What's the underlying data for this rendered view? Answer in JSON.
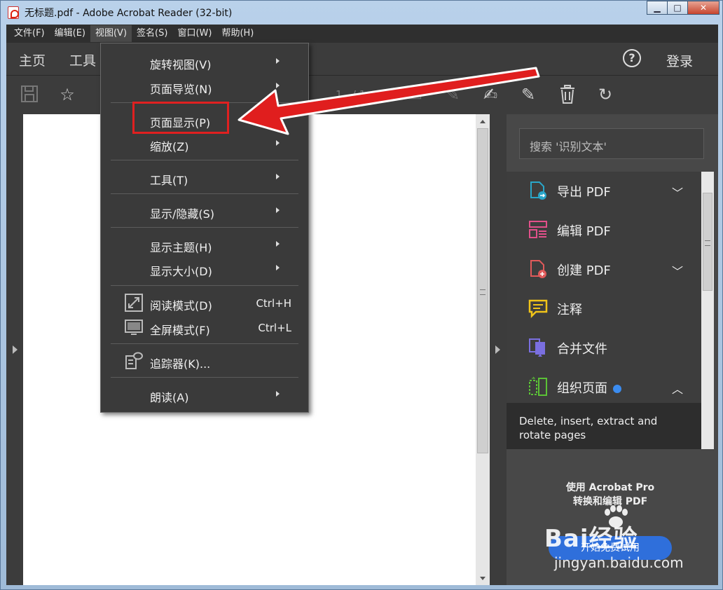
{
  "window": {
    "title": "无标题.pdf - Adobe Acrobat Reader (32-bit)",
    "minimize": "▁",
    "maximize": "□",
    "close": "✕"
  },
  "menubar": [
    "文件(F)",
    "编辑(E)",
    "视图(V)",
    "签名(S)",
    "窗口(W)",
    "帮助(H)"
  ],
  "nav": {
    "home": "主页",
    "tools": "工具",
    "help": "?",
    "login": "登录"
  },
  "toolbar": {
    "page_current": "1",
    "page_total": "/ 1"
  },
  "view_menu": {
    "items": [
      {
        "label": "旋转视图(V)",
        "submenu": true
      },
      {
        "label": "页面导览(N)",
        "submenu": true
      },
      {
        "label": "页面显示(P)",
        "submenu": true,
        "highlighted": true
      },
      {
        "label": "缩放(Z)",
        "submenu": true
      },
      {
        "label": "工具(T)",
        "submenu": true
      },
      {
        "label": "显示/隐藏(S)",
        "submenu": true
      },
      {
        "label": "显示主题(H)",
        "submenu": true
      },
      {
        "label": "显示大小(D)",
        "submenu": true
      },
      {
        "label": "阅读模式(D)",
        "shortcut": "Ctrl+H",
        "icon": "read-mode-icon"
      },
      {
        "label": "全屏模式(F)",
        "shortcut": "Ctrl+L",
        "icon": "fullscreen-icon"
      },
      {
        "label": "追踪器(K)...",
        "icon": "tracker-icon"
      },
      {
        "label": "朗读(A)",
        "submenu": true
      }
    ]
  },
  "right_pane": {
    "search_placeholder": "搜索 '识别文本'",
    "tools": [
      {
        "label": "导出 PDF",
        "color": "#2aa6c9",
        "expand": "﹀"
      },
      {
        "label": "编辑 PDF",
        "color": "#e2508a"
      },
      {
        "label": "创建 PDF",
        "color": "#e05a5a",
        "expand": "﹀"
      },
      {
        "label": "注释",
        "color": "#f0c419"
      },
      {
        "label": "合并文件",
        "color": "#7a6fe0"
      },
      {
        "label": "组织页面",
        "color": "#5bc236",
        "expand": "︿"
      }
    ],
    "description": "Delete, insert, extract and rotate pages",
    "promo_line1": "使用 Acrobat Pro",
    "promo_line2": "转换和编辑 PDF",
    "promo_button": "开始免费试用"
  },
  "watermark": {
    "top": "Bai经验",
    "bottom": "jingyan.baidu.com"
  },
  "colors": {
    "accent_red": "#e02020",
    "app_dark": "#3c3c3c",
    "promo_blue": "#2f6fdb"
  }
}
